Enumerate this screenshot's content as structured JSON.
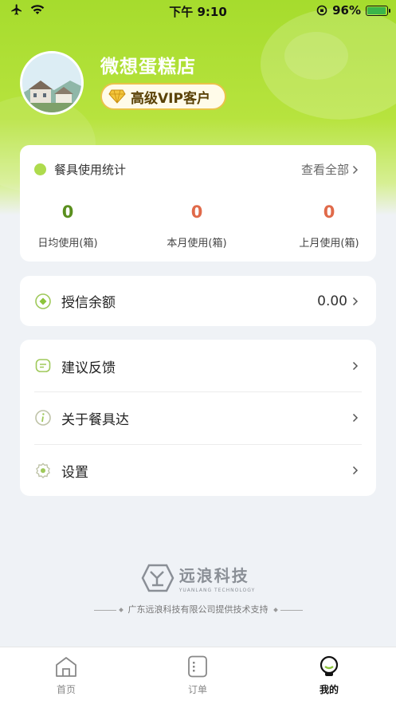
{
  "status_bar": {
    "time": "下午 9:10",
    "battery": "96%"
  },
  "profile": {
    "shop_name": "微想蛋糕店",
    "vip_label": "高级VIP客户"
  },
  "stats": {
    "title": "餐具使用统计",
    "view_all": "查看全部",
    "items": [
      {
        "value": "0",
        "label": "日均使用(箱)",
        "color": "#5a8f1e"
      },
      {
        "value": "0",
        "label": "本月使用(箱)",
        "color": "#e06a4a"
      },
      {
        "value": "0",
        "label": "上月使用(箱)",
        "color": "#e06a4a"
      }
    ]
  },
  "credit": {
    "label": "授信余额",
    "value": "0.00"
  },
  "menu": [
    {
      "label": "建议反馈",
      "icon": "feedback-icon"
    },
    {
      "label": "关于餐具达",
      "icon": "info-icon"
    },
    {
      "label": "设置",
      "icon": "settings-icon"
    }
  ],
  "footer": {
    "company_cn": "远浪科技",
    "company_en": "YUANLANG TECHNOLOGY",
    "support": "广东远浪科技有限公司提供技术支持"
  },
  "tabs": [
    {
      "label": "首页",
      "icon": "home-icon",
      "active": false
    },
    {
      "label": "订单",
      "icon": "order-icon",
      "active": false
    },
    {
      "label": "我的",
      "icon": "profile-icon",
      "active": true
    }
  ],
  "colors": {
    "accent": "#a6dc2d",
    "vip_border": "#e9c34a"
  }
}
